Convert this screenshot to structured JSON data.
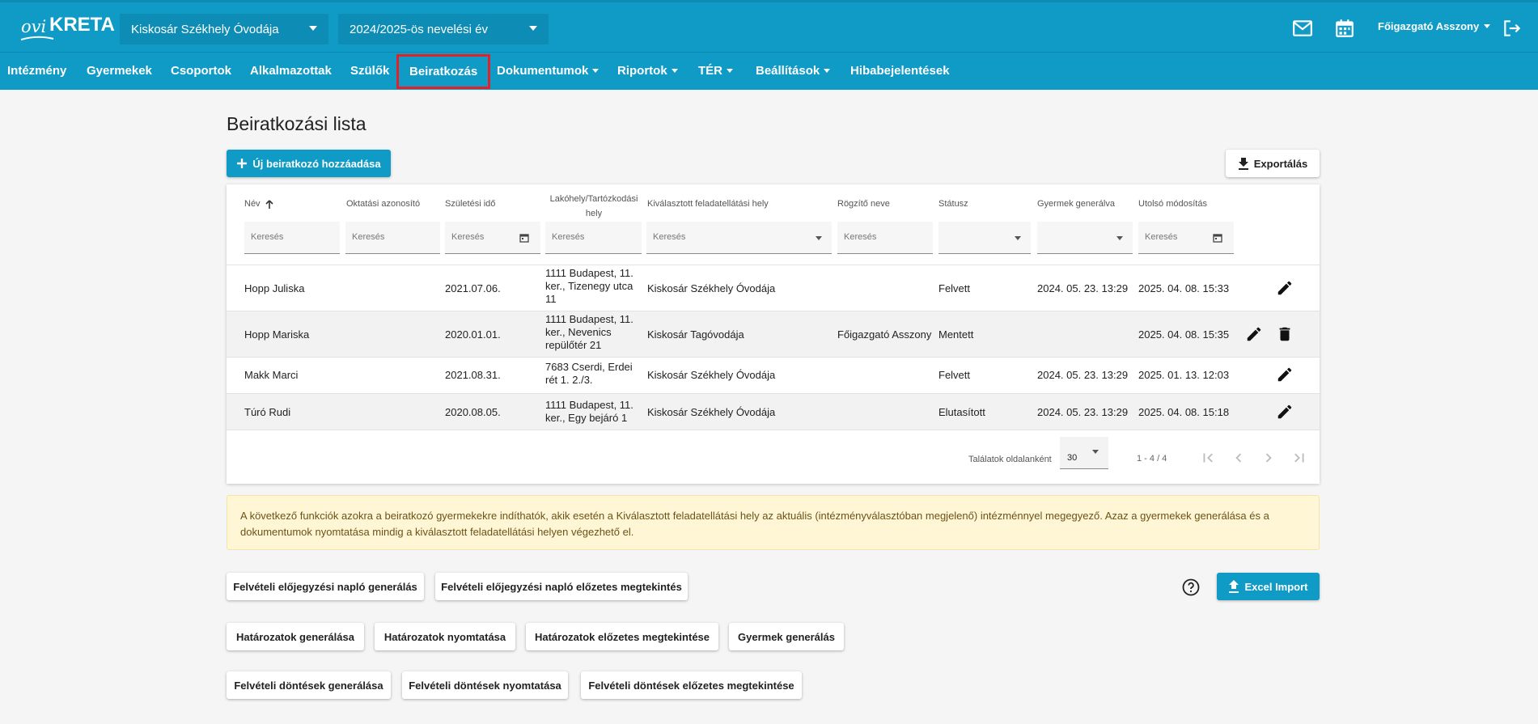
{
  "app": {
    "logo_prefix": "ovi",
    "logo_main": "KRETA",
    "institution": "Kiskosár Székhely Óvodája",
    "school_year": "2024/2025-ös nevelési év",
    "user": "Főigazgató Asszony"
  },
  "nav": {
    "items": [
      "Intézmény",
      "Gyermekek",
      "Csoportok",
      "Alkalmazottak",
      "Szülők",
      "Beiratkozás",
      "Dokumentumok",
      "Riportok",
      "TÉR",
      "Beállítások",
      "Hibabejelentések"
    ],
    "active": "Beiratkozás"
  },
  "page": {
    "title": "Beiratkozási lista",
    "add_button": "Új beiratkozó hozzáadása",
    "export_button": "Exportálás"
  },
  "table": {
    "headers": [
      "Név",
      "Oktatási azonosító",
      "Születési idő",
      "Lakóhely/Tartózkodási hely",
      "Kiválasztott feladatellátási hely",
      "Rögzítő neve",
      "Státusz",
      "Gyermek generálva",
      "Utolsó módosítás"
    ],
    "search_placeholder": "Keresés",
    "rows": [
      {
        "name": "Hopp Juliska",
        "id": "",
        "birth": "2021.07.06.",
        "address": "1111 Budapest, 11. ker., Tizenegy utca 11",
        "place": "Kiskosár Székhely Óvodája",
        "recorder": "",
        "status": "Felvett",
        "generated": "2024. 05. 23. 13:29",
        "modified": "2025. 04. 08. 15:33"
      },
      {
        "name": "Hopp Mariska",
        "id": "",
        "birth": "2020.01.01.",
        "address": "1111 Budapest, 11. ker., Nevenics repülőtér 21",
        "place": "Kiskosár Tagóvodája",
        "recorder": "Főigazgató Asszony",
        "status": "Mentett",
        "generated": "",
        "modified": "2025. 04. 08. 15:35"
      },
      {
        "name": "Makk Marci",
        "id": "",
        "birth": "2021.08.31.",
        "address": "7683 Cserdi, Erdei rét 1. 2./3.",
        "place": "Kiskosár Székhely Óvodája",
        "recorder": "",
        "status": "Felvett",
        "generated": "2024. 05. 23. 13:29",
        "modified": "2025. 01. 13. 12:03"
      },
      {
        "name": "Túró Rudi",
        "id": "",
        "birth": "2020.08.05.",
        "address": "1111 Budapest, 11. ker., Egy bejáró 1",
        "place": "Kiskosár Székhely Óvodája",
        "recorder": "",
        "status": "Elutasított",
        "generated": "2024. 05. 23. 13:29",
        "modified": "2025. 04. 08. 15:18"
      }
    ],
    "pager_label": "Találatok oldalanként",
    "page_size": "30",
    "range": "1 - 4 / 4"
  },
  "info_text": "A következő funkciók azokra a beiratkozó gyermekekre indíthatók, akik esetén a Kiválasztott feladatellátási hely az aktuális (intézményválasztóban megjelenő) intézménnyel megegyező. Azaz a gyermekek generálása és a dokumentumok nyomtatása mindig a kiválasztott feladatellátási helyen végezhető el.",
  "actions": {
    "row1": [
      "Felvételi előjegyzési napló generálás",
      "Felvételi előjegyzési napló előzetes megtekintés"
    ],
    "row2": [
      "Határozatok generálása",
      "Határozatok nyomtatása",
      "Határozatok előzetes megtekintése",
      "Gyermek generálás"
    ],
    "row3": [
      "Felvételi döntések generálása",
      "Felvételi döntések nyomtatása",
      "Felvételi döntések előzetes megtekintése"
    ],
    "excel_import": "Excel Import"
  },
  "colors": {
    "primary": "#0f9bc5",
    "active_outline": "#e0232a",
    "info_bg": "#fff6d5"
  }
}
